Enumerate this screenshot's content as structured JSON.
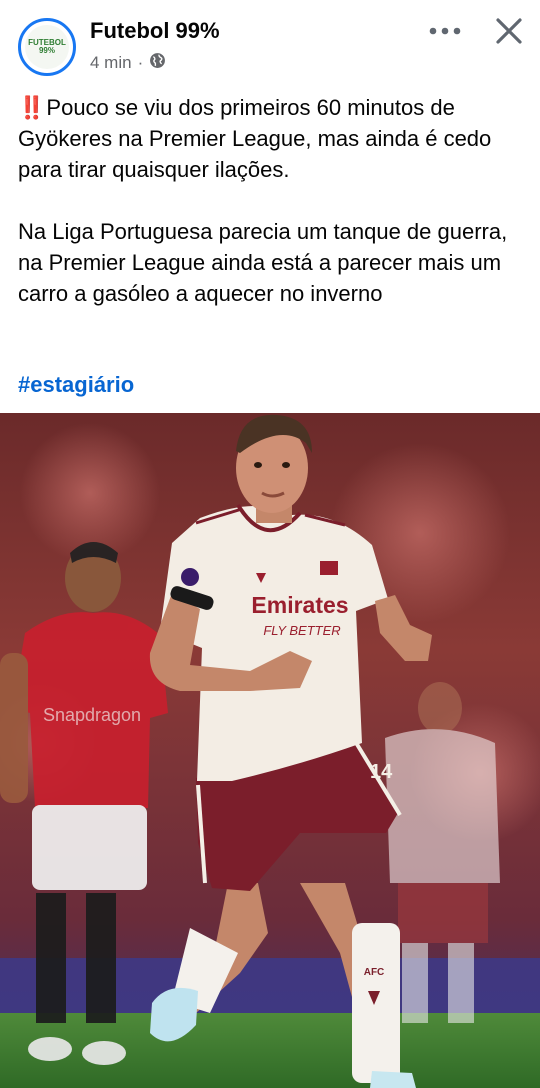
{
  "header": {
    "page_name": "Futebol 99%",
    "time": "4 min",
    "separator": "·",
    "avatar_text": "FUTEBOL 99%",
    "icons": {
      "more": "more-horizontal-icon",
      "close": "close-icon",
      "privacy": "globe-icon"
    }
  },
  "post": {
    "emoji": "‼️",
    "paragraph1": "Pouco se viu dos primeiros 60 minutos de Gyökeres na Premier League, mas ainda é cedo para tirar quaisquer ilações.",
    "paragraph2": "Na Liga Portuguesa parecia um tanque de guerra, na Premier League ainda está a parecer mais um carro a gasóleo a aquecer no inverno",
    "hashtag": "#estagiário"
  },
  "photo": {
    "sponsor_text": "Emirates",
    "sponsor_sub": "FLY BETTER",
    "shorts_text": "AFC",
    "background_sponsor": "Snapdragon"
  },
  "colors": {
    "accent": "#1877f2",
    "hashtag": "#0866d2",
    "text": "#050505",
    "secondary": "#65676b"
  }
}
